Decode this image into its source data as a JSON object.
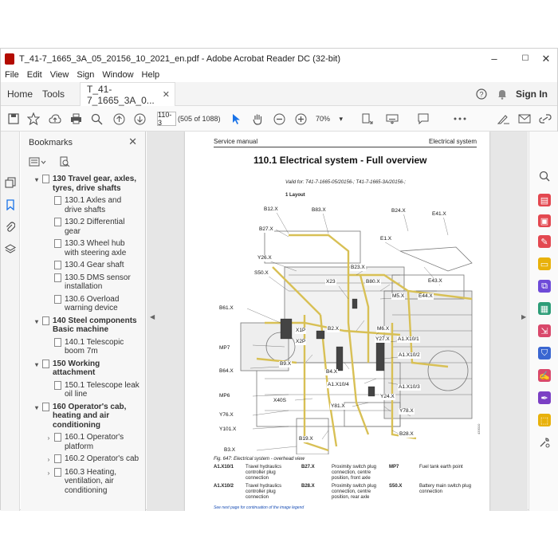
{
  "window": {
    "title": "T_41-7_1665_3A_05_20156_10_2021_en.pdf - Adobe Acrobat Reader DC (32-bit)",
    "controls": {
      "minimize": "–",
      "maximize": "☐",
      "close": "✕"
    }
  },
  "menu": [
    "File",
    "Edit",
    "View",
    "Sign",
    "Window",
    "Help"
  ],
  "tabs": {
    "home": "Home",
    "tools": "Tools",
    "doc": "T_41-7_1665_3A_0...",
    "close": "✕",
    "sign_in": "Sign In"
  },
  "toolbar": {
    "page_input": "110-3",
    "page_count": "(505 of 1088)",
    "zoom": "70%",
    "zoom_caret": "▾"
  },
  "bookmarks": {
    "header": "Bookmarks",
    "close": "✕",
    "items": [
      {
        "label": "130 Travel gear, axles, tyres, drive shafts",
        "level": 1,
        "toggle": "▾"
      },
      {
        "label": "130.1 Axles and drive shafts",
        "level": 2
      },
      {
        "label": "130.2 Differential gear",
        "level": 2
      },
      {
        "label": "130.3 Wheel hub with steering axle",
        "level": 2
      },
      {
        "label": "130.4 Gear shaft",
        "level": 2
      },
      {
        "label": "130.5 DMS sensor installation",
        "level": 2
      },
      {
        "label": "130.6 Overload warning device",
        "level": 2
      },
      {
        "label": "140 Steel components Basic machine",
        "level": 1,
        "toggle": "▾"
      },
      {
        "label": "140.1 Telescopic boom 7m",
        "level": 2
      },
      {
        "label": "150 Working attachment",
        "level": 1,
        "toggle": "▾"
      },
      {
        "label": "150.1 Telescope leak oil line",
        "level": 2
      },
      {
        "label": "160 Operator's cab, heating and air conditioning",
        "level": 1,
        "toggle": "▾"
      },
      {
        "label": "160.1 Operator's platform",
        "level": 2,
        "toggle": "›"
      },
      {
        "label": "160.2 Operator's cab",
        "level": 2,
        "toggle": "›"
      },
      {
        "label": "160.3 Heating, ventilation, air conditioning",
        "level": 2,
        "toggle": "›"
      }
    ]
  },
  "page": {
    "header_left": "Service manual",
    "header_right": "Electrical system",
    "title": "110.1    Electrical system - Full overview",
    "valid_for": "Valid for: T41-7-1665-05/20156-; T41-7-1665-3A/20156-;",
    "layout_label": "1 Layout",
    "figure_caption": "Fig. 647: Electrical system - overhead view",
    "diagram_labels": [
      "B12.X",
      "B83.X",
      "B24.X",
      "E41.X",
      "B27.X",
      "E1.X",
      "Y26.X",
      "B23.X",
      "S50.X",
      "X23",
      "B80.X",
      "M5.X",
      "E44.X",
      "E43.X",
      "B61.X",
      "X1P",
      "B2.X",
      "M6.X",
      "X2P",
      "Y27.X",
      "A1.X10/1",
      "MP7",
      "B9.X",
      "A1.X10/2",
      "B64.X",
      "B4.X",
      "A1.X10/4",
      "A1.X10/3",
      "MP6",
      "X40S",
      "Y24.X",
      "Y81.X",
      "Y76.X",
      "Y78.X",
      "Y101.X",
      "B19.X",
      "B28.X",
      "B3.X"
    ],
    "legend": [
      {
        "code": "A1.X10/1",
        "text": "Travel hydraulics controller plug connection"
      },
      {
        "code": "B27.X",
        "text": "Proximity switch plug connection, centre position, front axle"
      },
      {
        "code": "MP7",
        "text": "Fuel tank earth point"
      },
      {
        "code": "A1.X10/2",
        "text": "Travel hydraulics controller plug connection"
      },
      {
        "code": "B28.X",
        "text": "Proximity switch plug connection, centre position, rear axle"
      },
      {
        "code": "S50.X",
        "text": "Battery main switch plug connection"
      }
    ],
    "see_next": "See next page for continuation of the image legend"
  },
  "icons": {
    "left_nav": [
      "copy-pages-icon",
      "bookmark-icon",
      "attachment-icon",
      "layers-icon"
    ],
    "right_tools": [
      "search-zoom-icon",
      "export-pdf-icon",
      "create-pdf-icon",
      "edit-pdf-icon",
      "comment-icon",
      "combine-icon",
      "organize-icon",
      "compress-icon",
      "protect-icon",
      "fill-sign-icon",
      "send-sign-icon",
      "stamp-icon",
      "more-tools-icon"
    ]
  },
  "colors": {
    "accent": "#1a73e8",
    "acrobat_red": "#b30b00",
    "wire_yellow": "#d8c055"
  }
}
